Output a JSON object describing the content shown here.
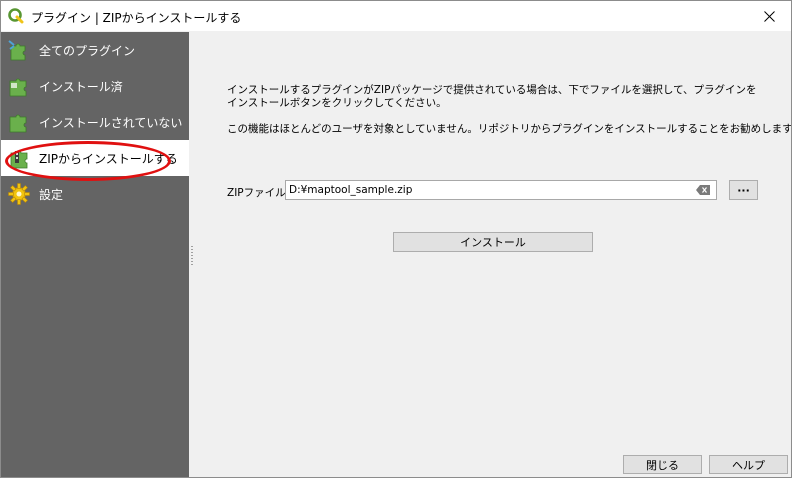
{
  "window": {
    "title": "プラグイン | ZIPからインストールする"
  },
  "sidebar": {
    "items": [
      {
        "label": "全てのプラグイン",
        "icon": "all-plugins-icon"
      },
      {
        "label": "インストール済",
        "icon": "installed-plugins-icon"
      },
      {
        "label": "インストールされていない",
        "icon": "not-installed-plugins-icon"
      },
      {
        "label": "ZIPからインストールする",
        "icon": "install-from-zip-icon",
        "active": true
      },
      {
        "label": "設定",
        "icon": "settings-gear-icon"
      }
    ],
    "highlight_color": "#e01010"
  },
  "main": {
    "description": "インストールするプラグインがZIPパッケージで提供されている場合は、下でファイルを選択して、プラグインをインストールボタンをクリックしてください。",
    "warning": "この機能はほとんどのユーザを対象としていません。リポジトリからプラグインをインストールすることをお勧めします。",
    "zip_label": "ZIPファイル:",
    "zip_value": "D:¥maptool_sample.zip",
    "browse_label": "···",
    "install_label": "インストール"
  },
  "footer": {
    "close_label": "閉じる",
    "help_label": "ヘルプ"
  },
  "colors": {
    "sidebar_bg": "#646464",
    "accent_green": "#6ab04c",
    "qgis_yellow": "#f1c40f"
  }
}
